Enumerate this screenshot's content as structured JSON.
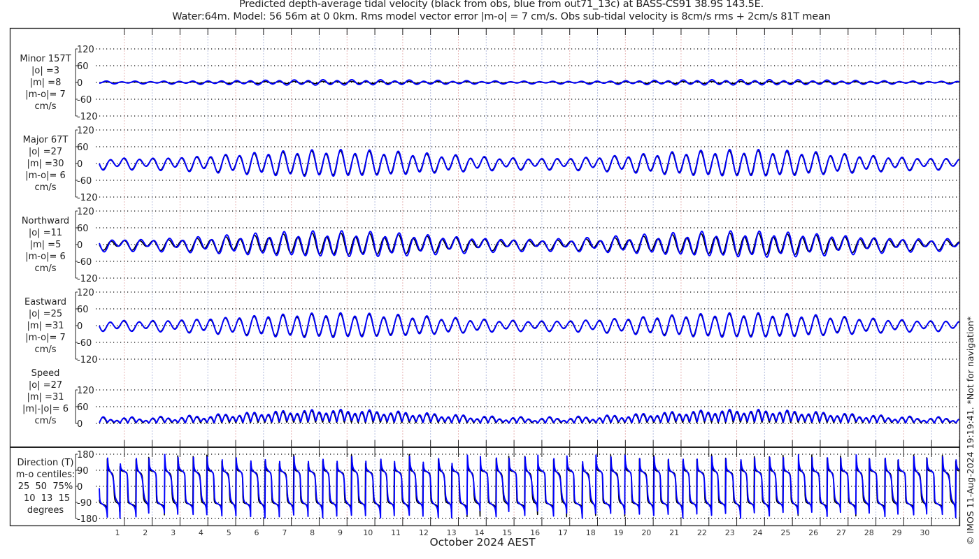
{
  "title_line1": "Predicted depth-average tidal velocity (black from obs, blue from out71_13c) at BASS-CS91 38.9S 143.5E.",
  "title_line2": "Water:64m. Model: 56 56m at 0 0km. Rms model vector error |m-o| = 7 cm/s. Obs sub-tidal velocity is 8cm/s rms + 2cm/s 81T mean",
  "credit": "© IMOS 11-Aug-2024 19:19:41. *Not for navigation*",
  "colors": {
    "obs": "#000000",
    "model": "#0000ff",
    "grid": "#000000",
    "day_line_a": "#e8b8b8",
    "day_line_b": "#b8c0e0"
  },
  "chart_data": {
    "type": "line",
    "xlabel": "October 2024 AEST",
    "x_unit": "days",
    "xlim": [
      0,
      31
    ],
    "x_tick_labels": [
      "1",
      "2",
      "3",
      "4",
      "5",
      "6",
      "7",
      "8",
      "9",
      "10",
      "11",
      "12",
      "13",
      "14",
      "15",
      "16",
      "17",
      "18",
      "19",
      "20",
      "21",
      "22",
      "23",
      "24",
      "25",
      "26",
      "27",
      "28",
      "29",
      "30"
    ],
    "series_legend": [
      {
        "name": "obs",
        "color": "black"
      },
      {
        "name": "model out71_13c",
        "color": "blue"
      }
    ],
    "grid": "dotted horizontal at ticks, dotted vertical daily",
    "panels": [
      {
        "id": "minor",
        "label": [
          "Minor 157T",
          "|o| =3",
          "|m| =8",
          "|m-o|= 7",
          "cm/s"
        ],
        "ylim": [
          -120,
          120
        ],
        "ticks": [
          "120",
          "60",
          "0",
          "-60",
          "-120"
        ],
        "kind": "minor",
        "approx_amplitude": 10
      },
      {
        "id": "major",
        "label": [
          "Major 67T",
          "|o| =27",
          "|m| =30",
          "|m-o|= 6",
          "cm/s"
        ],
        "ylim": [
          -120,
          120
        ],
        "ticks": [
          "120",
          "60",
          "0",
          "-60",
          "-120"
        ],
        "kind": "major",
        "approx_amplitude": 65
      },
      {
        "id": "northward",
        "label": [
          "Northward",
          "|o| =11",
          "|m| =5",
          "|m-o|= 6",
          "cm/s"
        ],
        "ylim": [
          -120,
          120
        ],
        "ticks": [
          "120",
          "60",
          "0",
          "-60",
          "-120"
        ],
        "kind": "north",
        "approx_amplitude": 25
      },
      {
        "id": "eastward",
        "label": [
          "Eastward",
          "|o| =25",
          "|m| =31",
          "|m-o|= 7",
          "cm/s"
        ],
        "ylim": [
          -120,
          120
        ],
        "ticks": [
          "120",
          "60",
          "0",
          "-60",
          "-120"
        ],
        "kind": "east",
        "approx_amplitude": 65
      },
      {
        "id": "speed",
        "label": [
          "Speed",
          "|o| =27",
          "|m| =31",
          "|m|-|o|= 6",
          "cm/s"
        ],
        "ylim": [
          0,
          120
        ],
        "ticks": [
          "120",
          "60",
          "0"
        ],
        "kind": "speed",
        "approx_amplitude": 70
      },
      {
        "id": "direction",
        "label": [
          "Direction (T)",
          "m-o centiles:",
          "25  50  75%",
          " 10  13  15",
          "degrees"
        ],
        "ylim": [
          -180,
          180
        ],
        "ticks": [
          "180",
          "90",
          "0",
          "-90",
          "-180"
        ],
        "kind": "dir"
      }
    ]
  }
}
